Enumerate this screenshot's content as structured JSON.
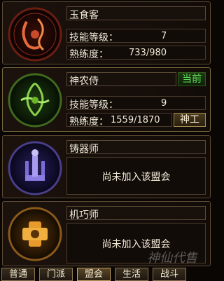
{
  "professions": [
    {
      "name": "玉食客",
      "skill_level_label": "技能等级：",
      "skill_level": "7",
      "proficiency_label": "熟练度：",
      "proficiency": "733/980"
    },
    {
      "name": "神农侍",
      "status_tag": "当前",
      "skill_level_label": "技能等级：",
      "skill_level": "9",
      "proficiency_label": "熟练度：",
      "proficiency": "1559/1870",
      "work_button": "神工"
    },
    {
      "name": "铸器师",
      "message": "尚未加入该盟会"
    },
    {
      "name": "机巧师",
      "message": "尚未加入该盟会"
    }
  ],
  "tabs": [
    "普通",
    "门派",
    "盟会",
    "生活",
    "战斗"
  ],
  "watermark": "神仙代售",
  "colors": {
    "food": "#c84a2a",
    "farmer": "#6fb52c",
    "smith": "#7b6cd8",
    "craft": "#e89a2a",
    "current_tag": "#5fe05a"
  }
}
